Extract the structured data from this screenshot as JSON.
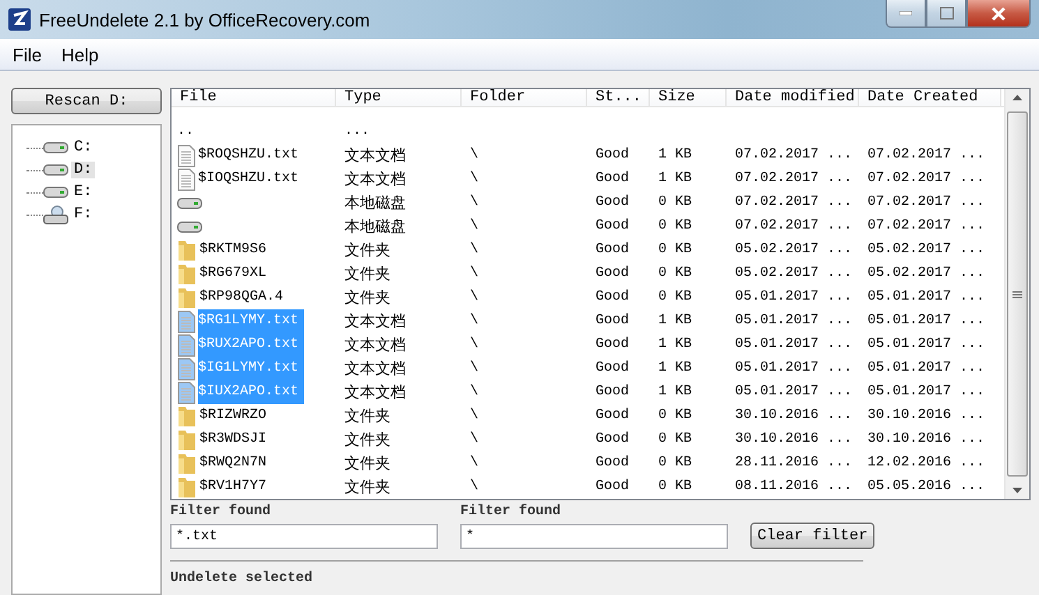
{
  "window": {
    "title": "FreeUndelete 2.1 by OfficeRecovery.com"
  },
  "menu": [
    "File",
    "Help"
  ],
  "rescan_button": "Rescan D:",
  "drives": [
    {
      "label": "C:",
      "kind": "disk",
      "selected": false
    },
    {
      "label": "D:",
      "kind": "disk",
      "selected": true
    },
    {
      "label": "E:",
      "kind": "disk",
      "selected": false
    },
    {
      "label": "F:",
      "kind": "removable",
      "selected": false
    }
  ],
  "table": {
    "columns": [
      "File",
      "Type",
      "Folder",
      "St...",
      "Size",
      "Date modified",
      "Date Created"
    ],
    "rows": [
      {
        "kind": "parent",
        "cells": [
          "..",
          "...",
          "",
          "",
          "",
          "",
          ""
        ],
        "selected": false
      },
      {
        "kind": "file",
        "cells": [
          "$ROQSHZU.txt",
          "文本文档",
          "\\",
          "Good",
          "1 KB",
          "07.02.2017 ...",
          "07.02.2017 ..."
        ],
        "selected": false
      },
      {
        "kind": "file",
        "cells": [
          "$IOQSHZU.txt",
          "文本文档",
          "\\",
          "Good",
          "1 KB",
          "07.02.2017 ...",
          "07.02.2017 ..."
        ],
        "selected": false
      },
      {
        "kind": "drive",
        "cells": [
          "",
          "本地磁盘",
          "\\",
          "Good",
          "0 KB",
          "07.02.2017 ...",
          "07.02.2017 ..."
        ],
        "selected": false
      },
      {
        "kind": "drive",
        "cells": [
          "",
          "本地磁盘",
          "\\",
          "Good",
          "0 KB",
          "07.02.2017 ...",
          "07.02.2017 ..."
        ],
        "selected": false
      },
      {
        "kind": "folder",
        "cells": [
          "$RKTM9S6",
          "文件夹",
          "\\",
          "Good",
          "0 KB",
          "05.02.2017 ...",
          "05.02.2017 ..."
        ],
        "selected": false
      },
      {
        "kind": "folder",
        "cells": [
          "$RG679XL",
          "文件夹",
          "\\",
          "Good",
          "0 KB",
          "05.02.2017 ...",
          "05.02.2017 ..."
        ],
        "selected": false
      },
      {
        "kind": "folder",
        "cells": [
          "$RP98QGA.4",
          "文件夹",
          "\\",
          "Good",
          "0 KB",
          "05.01.2017 ...",
          "05.01.2017 ..."
        ],
        "selected": false
      },
      {
        "kind": "file",
        "cells": [
          "$RG1LYMY.txt",
          "文本文档",
          "\\",
          "Good",
          "1 KB",
          "05.01.2017 ...",
          "05.01.2017 ..."
        ],
        "selected": true
      },
      {
        "kind": "file",
        "cells": [
          "$RUX2APO.txt",
          "文本文档",
          "\\",
          "Good",
          "1 KB",
          "05.01.2017 ...",
          "05.01.2017 ..."
        ],
        "selected": true
      },
      {
        "kind": "file",
        "cells": [
          "$IG1LYMY.txt",
          "文本文档",
          "\\",
          "Good",
          "1 KB",
          "05.01.2017 ...",
          "05.01.2017 ..."
        ],
        "selected": true
      },
      {
        "kind": "file",
        "cells": [
          "$IUX2APO.txt",
          "文本文档",
          "\\",
          "Good",
          "1 KB",
          "05.01.2017 ...",
          "05.01.2017 ..."
        ],
        "selected": true
      },
      {
        "kind": "folder",
        "cells": [
          "$RIZWRZO",
          "文件夹",
          "\\",
          "Good",
          "0 KB",
          "30.10.2016 ...",
          "30.10.2016 ..."
        ],
        "selected": false
      },
      {
        "kind": "folder",
        "cells": [
          "$R3WDSJI",
          "文件夹",
          "\\",
          "Good",
          "0 KB",
          "30.10.2016 ...",
          "30.10.2016 ..."
        ],
        "selected": false
      },
      {
        "kind": "folder",
        "cells": [
          "$RWQ2N7N",
          "文件夹",
          "\\",
          "Good",
          "0 KB",
          "28.11.2016 ...",
          "12.02.2016 ..."
        ],
        "selected": false
      },
      {
        "kind": "folder",
        "cells": [
          "$RV1H7Y7",
          "文件夹",
          "\\",
          "Good",
          "0 KB",
          "08.11.2016 ...",
          "05.05.2016 ..."
        ],
        "selected": false
      }
    ]
  },
  "filters": [
    {
      "label": "Filter found",
      "value": "*.txt"
    },
    {
      "label": "Filter found",
      "value": "*"
    }
  ],
  "clear_filter_button": "Clear filter",
  "undelete_label": "Undelete selected"
}
